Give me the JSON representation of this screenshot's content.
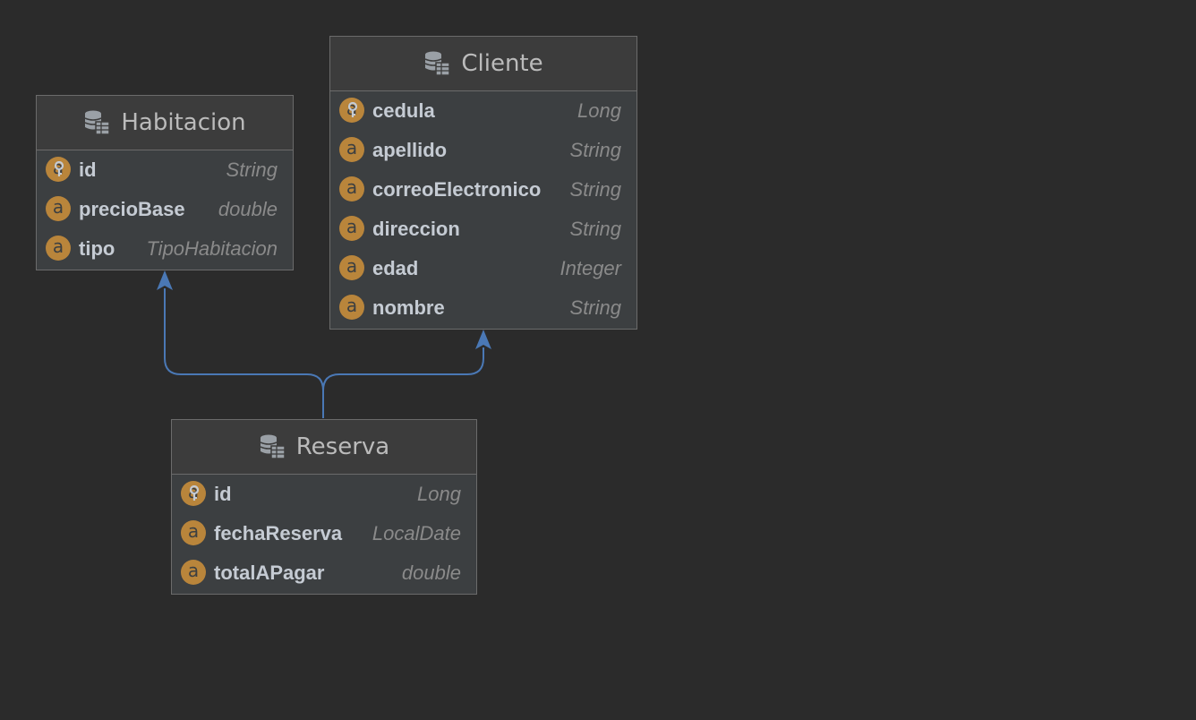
{
  "diagram": {
    "entities": {
      "cliente": {
        "title": "Cliente",
        "attributes": [
          {
            "name": "cedula",
            "type": "Long",
            "key": true
          },
          {
            "name": "apellido",
            "type": "String",
            "key": false
          },
          {
            "name": "correoElectronico",
            "type": "String",
            "key": false
          },
          {
            "name": "direccion",
            "type": "String",
            "key": false
          },
          {
            "name": "edad",
            "type": "Integer",
            "key": false
          },
          {
            "name": "nombre",
            "type": "String",
            "key": false
          }
        ]
      },
      "habitacion": {
        "title": "Habitacion",
        "attributes": [
          {
            "name": "id",
            "type": "String",
            "key": true
          },
          {
            "name": "precioBase",
            "type": "double",
            "key": false
          },
          {
            "name": "tipo",
            "type": "TipoHabitacion",
            "key": false
          }
        ]
      },
      "reserva": {
        "title": "Reserva",
        "attributes": [
          {
            "name": "id",
            "type": "Long",
            "key": true
          },
          {
            "name": "fechaReserva",
            "type": "LocalDate",
            "key": false
          },
          {
            "name": "totalAPagar",
            "type": "double",
            "key": false
          }
        ]
      }
    },
    "relations": [
      {
        "from": "reserva",
        "to": "habitacion"
      },
      {
        "from": "reserva",
        "to": "cliente"
      }
    ],
    "badge_letter": "a",
    "icons": {
      "entity": "database-table-icon",
      "attribute": "attribute-badge-icon",
      "primary_key": "key-icon"
    },
    "colors": {
      "background": "#2b2b2b",
      "entity_fill": "#3c3f41",
      "badge": "#b9853b",
      "connector": "#4a78b5",
      "attribute_name": "#c5cbd3",
      "attribute_type": "#8a8a8a"
    }
  }
}
